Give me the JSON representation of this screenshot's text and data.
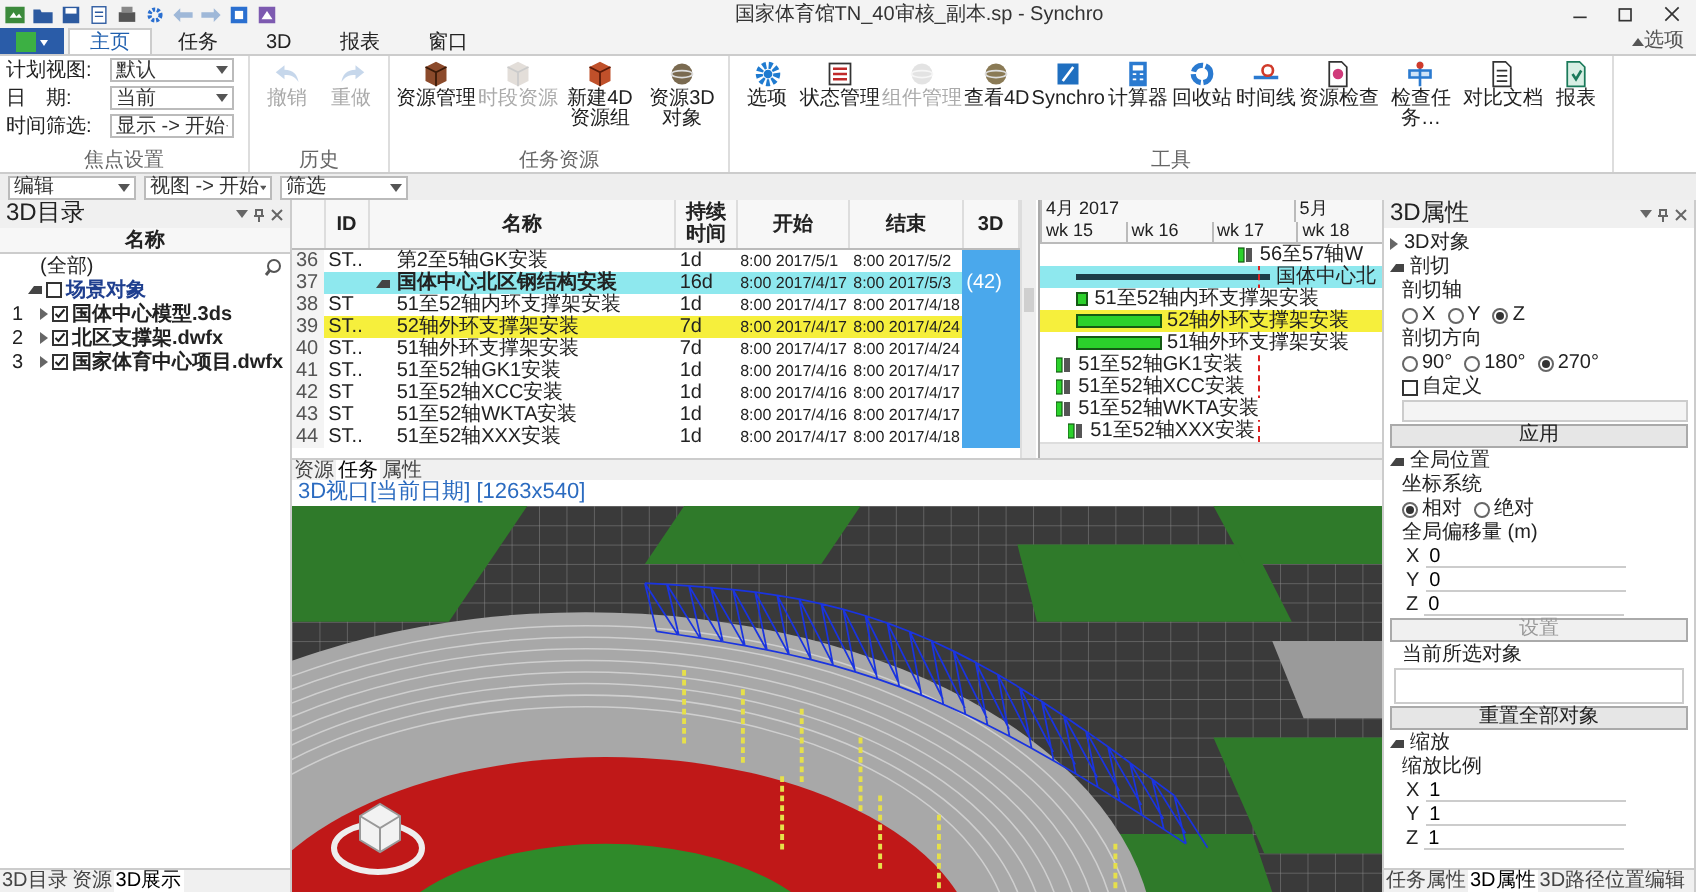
{
  "window": {
    "title": "国家体育馆TN_40审核_副本.sp - Synchro"
  },
  "ribbon_tabs": [
    {
      "label": "主页",
      "selected": true
    },
    {
      "label": "任务",
      "selected": false
    },
    {
      "label": "3D",
      "selected": false
    },
    {
      "label": "报表",
      "selected": false
    },
    {
      "label": "窗口",
      "selected": false
    }
  ],
  "ribbon_options": "选项",
  "focus_group": {
    "label": "焦点设置",
    "fields": [
      {
        "label": "计划视图:",
        "value": "默认"
      },
      {
        "label": "日　期:",
        "value": "当前"
      },
      {
        "label": "时间筛选:",
        "value": "显示 -> 开始"
      }
    ]
  },
  "button_groups": [
    {
      "label": "历史",
      "buttons": [
        {
          "label": "撤销",
          "disabled": true
        },
        {
          "label": "重做",
          "disabled": true
        }
      ]
    },
    {
      "label": "任务资源",
      "buttons": [
        {
          "label": "资源管理",
          "disabled": false
        },
        {
          "label": "时段资源",
          "disabled": true
        },
        {
          "label": "新建4D资源组",
          "disabled": false
        },
        {
          "label": "资源3D对象",
          "disabled": false
        }
      ]
    },
    {
      "label": "工具",
      "buttons": [
        {
          "label": "选项",
          "disabled": false
        },
        {
          "label": "状态管理",
          "disabled": false
        },
        {
          "label": "组件管理",
          "disabled": true
        },
        {
          "label": "查看4D",
          "disabled": false
        },
        {
          "label": "Synchro",
          "disabled": false
        },
        {
          "label": "计算器",
          "disabled": false
        },
        {
          "label": "回收站",
          "disabled": false
        },
        {
          "label": "时间线",
          "disabled": false
        },
        {
          "label": "资源检查",
          "disabled": false
        },
        {
          "label": "检查任务…",
          "disabled": false
        },
        {
          "label": "对比文档",
          "disabled": false
        },
        {
          "label": "报表",
          "disabled": false
        }
      ]
    }
  ],
  "filter_bar": [
    {
      "value": "编辑"
    },
    {
      "value": "视图 -> 开始"
    },
    {
      "value": "筛选"
    }
  ],
  "catalog_panel": {
    "title": "3D目录",
    "column": "名称",
    "filter": "(全部)",
    "tree": [
      {
        "label": "场景对象",
        "checked": false,
        "expanded": true,
        "children": [
          {
            "number": "1",
            "label": "国体中心模型.3ds",
            "checked": true,
            "expanded": false
          },
          {
            "number": "2",
            "label": "北区支撑架.dwfx",
            "checked": true,
            "expanded": false
          },
          {
            "number": "3",
            "label": "国家体育中心项目.dwfx",
            "checked": true,
            "expanded": false
          }
        ]
      }
    ],
    "tabs": [
      {
        "label": "3D目录",
        "selected": false
      },
      {
        "label": "资源",
        "selected": false
      },
      {
        "label": "3D展示",
        "selected": true
      }
    ]
  },
  "task_table": {
    "columns": [
      "ID",
      "名称",
      "持续时间",
      "开始",
      "结束",
      "3D"
    ],
    "rows": [
      {
        "number": "36",
        "id": "ST..",
        "name": "第2至5轴GK安装",
        "duration": "1d",
        "start": "8:00 2017/5/1",
        "finish": "8:00 2017/5/2",
        "kind": "milestone",
        "selected": false,
        "highlighted": false
      },
      {
        "number": "37",
        "id": "",
        "name": "国体中心北区钢结构安装",
        "duration": "16d",
        "start": "8:00 2017/4/17",
        "finish": "8:00 2017/5/3",
        "kind": "summary",
        "selected": true,
        "highlighted": false,
        "resources": "(42)"
      },
      {
        "number": "38",
        "id": "ST",
        "name": "51至52轴内环支撑架安装",
        "duration": "1d",
        "start": "8:00 2017/4/17",
        "finish": "8:00 2017/4/18",
        "kind": "task",
        "selected": false,
        "highlighted": false
      },
      {
        "number": "39",
        "id": "ST..",
        "name": "52轴外环支撑架安装",
        "duration": "7d",
        "start": "8:00 2017/4/17",
        "finish": "8:00 2017/4/24",
        "kind": "task",
        "selected": false,
        "highlighted": true
      },
      {
        "number": "40",
        "id": "ST..",
        "name": "51轴外环支撑架安装",
        "duration": "7d",
        "start": "8:00 2017/4/17",
        "finish": "8:00 2017/4/24",
        "kind": "task",
        "selected": false,
        "highlighted": false
      },
      {
        "number": "41",
        "id": "ST..",
        "name": "51至52轴GK1安装",
        "duration": "1d",
        "start": "8:00 2017/4/16",
        "finish": "8:00 2017/4/17",
        "kind": "milestone",
        "selected": false,
        "highlighted": false
      },
      {
        "number": "42",
        "id": "ST",
        "name": "51至52轴XCC安装",
        "duration": "1d",
        "start": "8:00 2017/4/16",
        "finish": "8:00 2017/4/17",
        "kind": "milestone",
        "selected": false,
        "highlighted": false
      },
      {
        "number": "43",
        "id": "ST",
        "name": "51至52轴WKTA安装",
        "duration": "1d",
        "start": "8:00 2017/4/16",
        "finish": "8:00 2017/4/17",
        "kind": "milestone",
        "selected": false,
        "highlighted": false
      },
      {
        "number": "44",
        "id": "ST..",
        "name": "51至52轴XXX安装",
        "duration": "1d",
        "start": "8:00 2017/4/17",
        "finish": "8:00 2017/4/18",
        "kind": "milestone",
        "selected": false,
        "highlighted": false
      }
    ]
  },
  "gantt": {
    "months": [
      "4月 2017",
      "5月"
    ],
    "weeks": [
      "wk 15",
      "wk 16",
      "wk 17",
      "wk 18"
    ],
    "labels": [
      "56至57轴W",
      "国体中心北",
      "51至52轴内环支撑架安装",
      "52轴外环支撑架安装",
      "51轴外环支撑架安装",
      "51至52轴GK1安装",
      "51至52轴XCC安装",
      "51至52轴WKTA安装",
      "51至52轴XXX安装"
    ]
  },
  "center_tabs": [
    {
      "label": "资源",
      "selected": false
    },
    {
      "label": "任务",
      "selected": true
    },
    {
      "label": "属性",
      "selected": false
    }
  ],
  "viewport": {
    "title": "3D视口[当前日期] [1263x540]"
  },
  "properties_panel": {
    "title": "3D属性",
    "object_section": {
      "label": "3D对象",
      "expanded": false
    },
    "cut_section": {
      "label": "剖切",
      "expanded": true
    },
    "cut_axis": {
      "label": "剖切轴",
      "options": [
        {
          "label": "X",
          "selected": false
        },
        {
          "label": "Y",
          "selected": false
        },
        {
          "label": "Z",
          "selected": true
        }
      ]
    },
    "cut_direction": {
      "label": "剖切方向",
      "options": [
        {
          "label": "90°",
          "selected": false
        },
        {
          "label": "180°",
          "selected": false
        },
        {
          "label": "270°",
          "selected": true
        }
      ],
      "custom": {
        "label": "自定义",
        "checked": false
      }
    },
    "apply_button": {
      "label": "应用",
      "disabled": false
    },
    "position_section": {
      "label": "全局位置",
      "expanded": true
    },
    "coordinate_system": {
      "label": "坐标系统",
      "options": [
        {
          "label": "相对",
          "selected": true
        },
        {
          "label": "绝对",
          "selected": false
        }
      ]
    },
    "offset": {
      "label": "全局偏移量 (m)",
      "fields": [
        {
          "axis": "X",
          "value": "0"
        },
        {
          "axis": "Y",
          "value": "0"
        },
        {
          "axis": "Z",
          "value": "0"
        }
      ]
    },
    "set_button": {
      "label": "设置",
      "disabled": true
    },
    "selected_objects": {
      "label": "当前所选对象"
    },
    "reset_button": {
      "label": "重置全部对象",
      "disabled": false
    },
    "scale_section": {
      "label": "缩放",
      "expanded": true
    },
    "scale": {
      "label": "缩放比例",
      "fields": [
        {
          "axis": "X",
          "value": "1"
        },
        {
          "axis": "Y",
          "value": "1"
        },
        {
          "axis": "Z",
          "value": "1"
        }
      ]
    },
    "tabs": [
      {
        "label": "任务属性",
        "selected": false
      },
      {
        "label": "3D属性",
        "selected": true
      },
      {
        "label": "3D路径位置编辑",
        "selected": false
      }
    ]
  }
}
